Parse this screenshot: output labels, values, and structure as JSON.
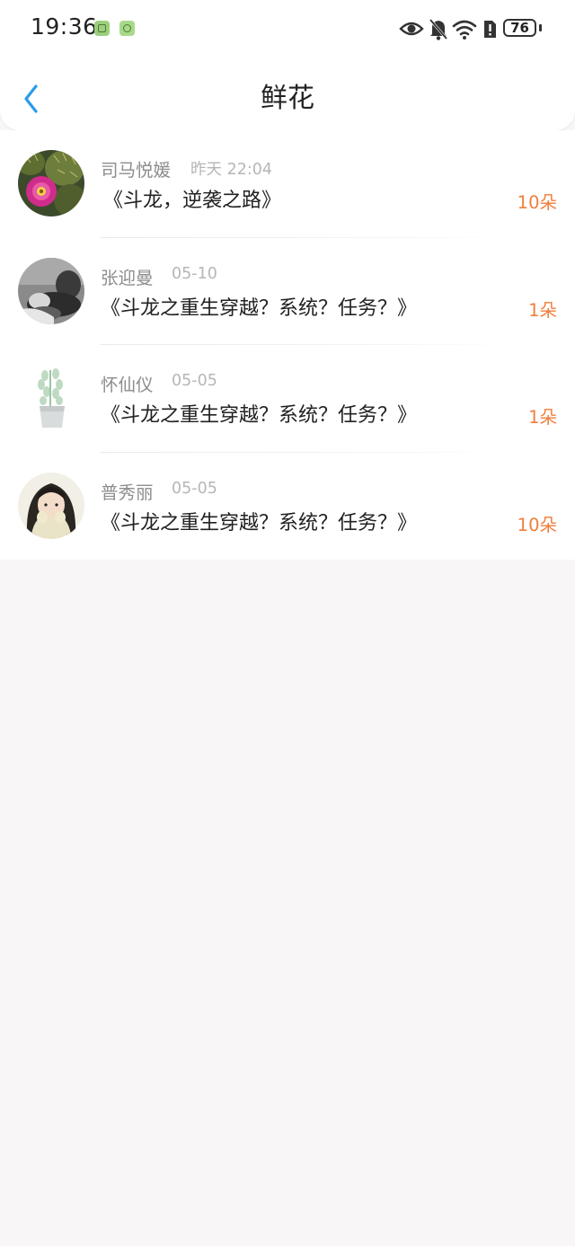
{
  "status_bar": {
    "time": "19:36",
    "battery": "76"
  },
  "header": {
    "title": "鲜花"
  },
  "colors": {
    "accent_blue": "#2a9ce8",
    "count_orange": "#f07e3b",
    "background": "#f8f6f7"
  },
  "items": [
    {
      "name": "司马悦媛",
      "date": "昨天 22:04",
      "book": "《斗龙，逆袭之路》",
      "count": "10朵",
      "avatar_icon": "cactus-flower-avatar"
    },
    {
      "name": "张迎曼",
      "date": "05-10",
      "book": "《斗龙之重生穿越？系统？任务？》",
      "count": "1朵",
      "avatar_icon": "bw-photo-avatar"
    },
    {
      "name": "怀仙仪",
      "date": "05-05",
      "book": "《斗龙之重生穿越？系统？任务？》",
      "count": "1朵",
      "avatar_icon": "potted-plant-avatar"
    },
    {
      "name": "普秀丽",
      "date": "05-05",
      "book": "《斗龙之重生穿越？系统？任务？》",
      "count": "10朵",
      "avatar_icon": "girl-avatar"
    }
  ]
}
